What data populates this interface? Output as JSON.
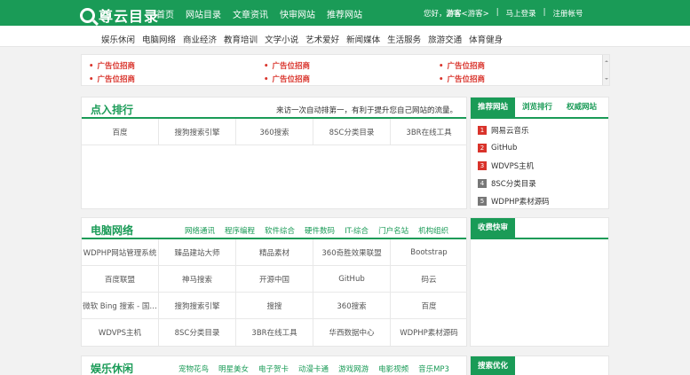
{
  "header": {
    "logo_text": "尊云目录",
    "nav": [
      "首页",
      "网站目录",
      "文章资讯",
      "快审网站",
      "推荐网站"
    ],
    "user": {
      "greeting": "您好，",
      "name": "游客",
      "role": "<游客>",
      "login": "马上登录",
      "separator": "|",
      "register": "注册帐号"
    }
  },
  "categories": [
    "娱乐休闲",
    "电脑网络",
    "商业经济",
    "教育培训",
    "文学小说",
    "艺术爱好",
    "新闻媒体",
    "生活服务",
    "旅游交通",
    "体育健身"
  ],
  "ads": {
    "label": "广告位招商",
    "rows": [
      [
        "广告位招商",
        "广告位招商",
        "广告位招商"
      ],
      [
        "广告位招商",
        "广告位招商",
        "广告位招商"
      ]
    ]
  },
  "ranking": {
    "title": "点入排行",
    "note": "来访一次自动排第一，有利于提升您自己网站的流量。",
    "sites": [
      "百度",
      "搜狗搜索引擎",
      "360搜索",
      "8SC分类目录",
      "3BR在线工具"
    ]
  },
  "side_tabs": [
    "推荐网站",
    "浏览排行",
    "权威网站"
  ],
  "recommended": [
    {
      "rank": "1",
      "name": "网易云音乐"
    },
    {
      "rank": "2",
      "name": "GitHub"
    },
    {
      "rank": "3",
      "name": "WDVPS主机"
    },
    {
      "rank": "4",
      "name": "8SC分类目录"
    },
    {
      "rank": "5",
      "name": "WDPHP素材源码"
    }
  ],
  "computer": {
    "title": "电脑网络",
    "subnav": [
      "网络通讯",
      "程序编程",
      "软件综合",
      "硬件数码",
      "IT-综合",
      "门户名站",
      "机构组织"
    ],
    "side_tab": "收费快审",
    "grid": [
      [
        "WDPHP网站管理系统",
        "臻品建站大师",
        "精品素材",
        "360奇胜效果联盟",
        "Bootstrap"
      ],
      [
        "百度联盟",
        "神马搜索",
        "开源中国",
        "GitHub",
        "码云"
      ],
      [
        "微软 Bing 搜索 - 国…",
        "搜狗搜索引擎",
        "搜搜",
        "360搜索",
        "百度"
      ],
      [
        "WDVPS主机",
        "8SC分类目录",
        "3BR在线工具",
        "华西数据中心",
        "WDPHP素材源码"
      ]
    ]
  },
  "leisure": {
    "title": "娱乐休闲",
    "subnav": [
      "宠物花鸟",
      "明星美女",
      "电子贺卡",
      "动漫卡通",
      "游戏网游",
      "电影视频",
      "音乐MP3"
    ],
    "side_tab": "搜索优化"
  },
  "colors": {
    "brand": "#1a9b57",
    "ad_red": "#d9332b"
  }
}
